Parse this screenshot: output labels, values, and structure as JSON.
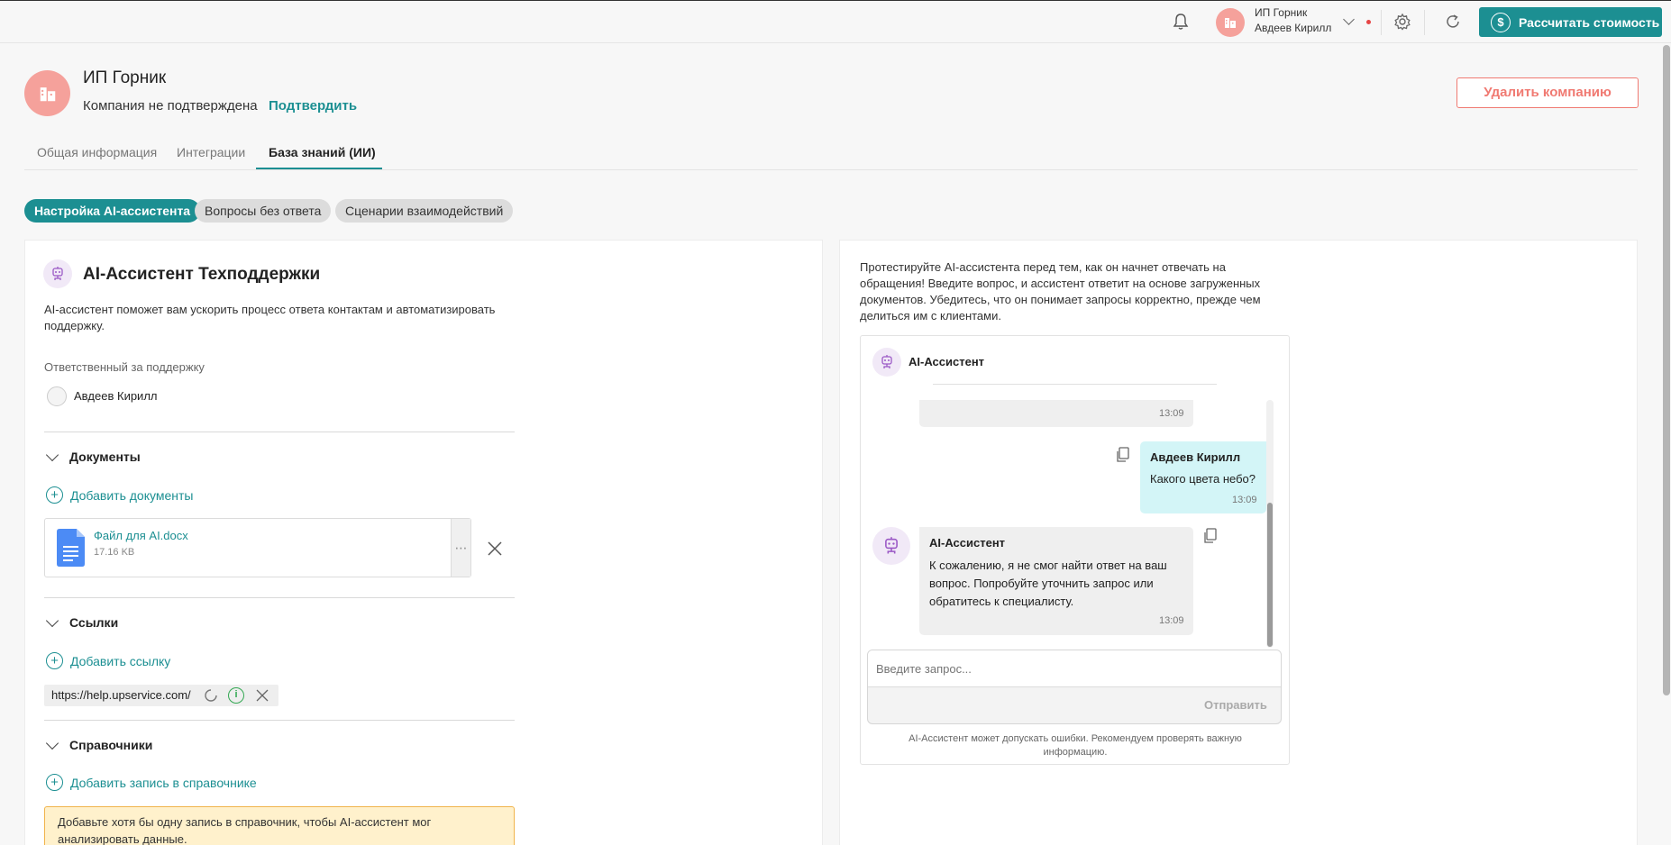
{
  "topbar": {
    "user_company": "ИП Горник",
    "user_name": "Авдеев Кирилл",
    "calc_button": "Рассчитать стоимость"
  },
  "company": {
    "name": "ИП Горник",
    "status": "Компания не подтверждена",
    "confirm_link": "Подтвердить",
    "delete_button": "Удалить компанию"
  },
  "tabs": [
    {
      "label": "Общая информация"
    },
    {
      "label": "Интеграции"
    },
    {
      "label": "База знаний (ИИ)"
    }
  ],
  "subtabs": [
    {
      "label": "Настройка AI-ассистента"
    },
    {
      "label": "Вопросы без ответа"
    },
    {
      "label": "Сценарии взаимодействий"
    }
  ],
  "assistant": {
    "title": "AI-Ассистент Техподдержки",
    "description": "AI-ассистент поможет вам ускорить процесс ответа контактам и автоматизировать поддержку.",
    "responsible_label": "Ответственный за поддержку",
    "responsible_name": "Авдеев Кирилл"
  },
  "documents": {
    "title": "Документы",
    "add_label": "Добавить документы",
    "file_name": "Файл для AI.docx",
    "file_size": "17.16 KB"
  },
  "links": {
    "title": "Ссылки",
    "add_label": "Добавить ссылку",
    "url": "https://help.upservice.com/"
  },
  "references": {
    "title": "Справочники",
    "add_label": "Добавить запись в справочнике",
    "warning": "Добавьте хотя бы одну запись в справочник, чтобы AI-ассистент мог анализировать данные."
  },
  "test": {
    "intro": "Протестируйте AI-ассистента перед тем, как он начнет отвечать на обращения! Введите вопрос, и ассистент ответит на основе загруженных документов. Убедитесь, что он понимает запросы корректно, прежде чем делиться им с клиентами."
  },
  "chat": {
    "title": "AI-Ассистент",
    "partial_time": "13:09",
    "user_msg_name": "Авдеев Кирилл",
    "user_msg_text": "Какого цвета небо?",
    "user_msg_time": "13:09",
    "bot_msg_name": "AI-Ассистент",
    "bot_msg_text": "К сожалению, я не смог найти ответ на ваш вопрос. Попробуйте уточнить запрос или обратитесь к специалисту.",
    "bot_msg_time": "13:09",
    "input_placeholder": "Введите запрос...",
    "send_button": "Отправить",
    "disclaimer": "AI-Ассистент может допускать ошибки. Рекомендуем проверять важную информацию."
  },
  "colors": {
    "accent": "#1c8f92",
    "danger": "#f07a72",
    "avatar_bg": "#f5a19b",
    "user_bubble": "#d3f5f7",
    "warning_bg": "#fff1cc"
  }
}
